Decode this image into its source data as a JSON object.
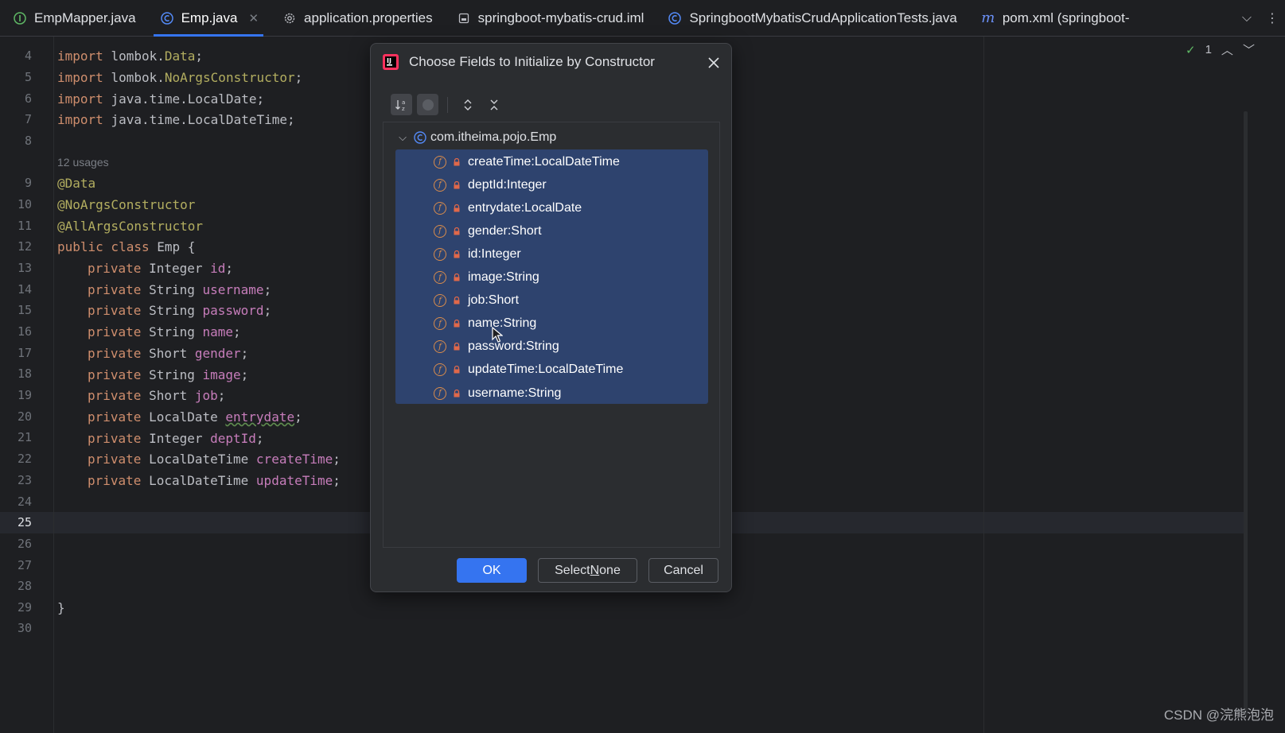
{
  "tabs": [
    {
      "label": "EmpMapper.java",
      "icon": "interface-icon",
      "active": false
    },
    {
      "label": "Emp.java",
      "icon": "class-icon",
      "active": true
    },
    {
      "label": "application.properties",
      "icon": "gear-icon",
      "active": false
    },
    {
      "label": "springboot-mybatis-crud.iml",
      "icon": "module-file-icon",
      "active": false
    },
    {
      "label": "SpringbootMybatisCrudApplicationTests.java",
      "icon": "class-icon",
      "active": false
    },
    {
      "label": "pom.xml (springboot-",
      "icon": "maven-icon",
      "active": false
    }
  ],
  "editor": {
    "usages": "12 usages",
    "line_numbers": [
      "4",
      "5",
      "6",
      "7",
      "8",
      "9",
      "10",
      "11",
      "12",
      "13",
      "14",
      "15",
      "16",
      "17",
      "18",
      "19",
      "20",
      "21",
      "22",
      "23",
      "24",
      "25",
      "26",
      "27",
      "28",
      "29",
      "30"
    ],
    "current_line": "25",
    "lines": {
      "l4a": "import ",
      "l4b": "lombok.",
      "l4c": "Data",
      "l4d": ";",
      "l5a": "import ",
      "l5b": "lombok.",
      "l5c": "NoArgsConstructor",
      "l5d": ";",
      "l6a": "import ",
      "l6b": "java.time.LocalDate;",
      "l7a": "import ",
      "l7b": "java.time.LocalDateTime;",
      "l9": "@Data",
      "l10": "@NoArgsConstructor",
      "l11": "@AllArgsConstructor",
      "l12a": "public class ",
      "l12b": "Emp {",
      "f": [
        {
          "type": "Integer ",
          "name": "id"
        },
        {
          "type": "String ",
          "name": "username"
        },
        {
          "type": "String ",
          "name": "password"
        },
        {
          "type": "String ",
          "name": "name"
        },
        {
          "type": "Short ",
          "name": "gender"
        },
        {
          "type": "String ",
          "name": "image"
        },
        {
          "type": "Short ",
          "name": "job"
        },
        {
          "type": "LocalDate ",
          "name": "entrydate"
        },
        {
          "type": "Integer ",
          "name": "deptId"
        },
        {
          "type": "LocalDateTime ",
          "name": "createTime"
        },
        {
          "type": "LocalDateTime ",
          "name": "updateTime"
        }
      ],
      "private_kw": "private ",
      "semicolon": ";",
      "l29": "}"
    },
    "inspection_count": "1"
  },
  "dialog": {
    "title": "Choose Fields to Initialize by Constructor",
    "root": "com.itheima.pojo.Emp",
    "fields": [
      "createTime:LocalDateTime",
      "deptId:Integer",
      "entrydate:LocalDate",
      "gender:Short",
      "id:Integer",
      "image:String",
      "job:Short",
      "name:String",
      "password:String",
      "updateTime:LocalDateTime",
      "username:String"
    ],
    "ok_label": "OK",
    "select_none_prefix": "Select ",
    "select_none_mnemonic": "N",
    "select_none_suffix": "one",
    "cancel_label": "Cancel"
  },
  "watermark": "CSDN @浣熊泡泡",
  "colors": {
    "accent": "#3574f0",
    "selection": "#2e436e",
    "keyword": "#cf8e6d",
    "annotation": "#b3ae60",
    "field": "#c77dbb",
    "field_icon": "#d98c4c"
  }
}
